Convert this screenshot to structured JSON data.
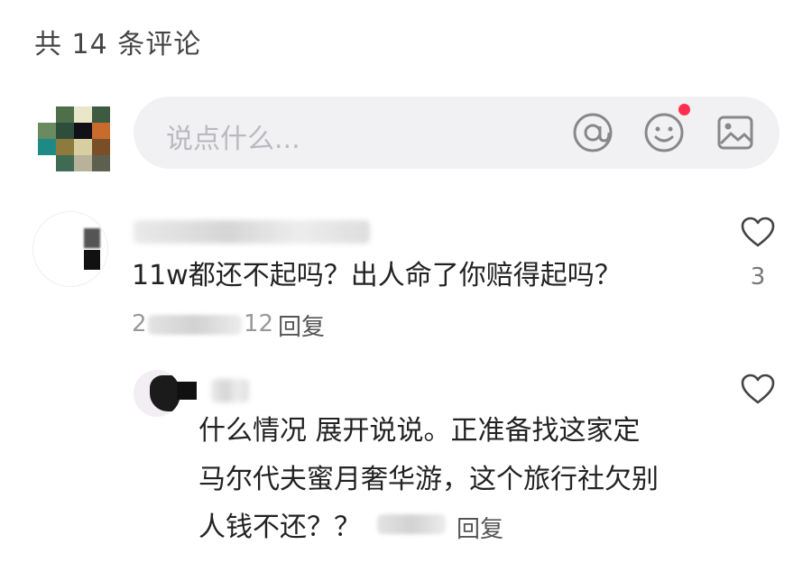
{
  "header": {
    "comment_count_title": "共 14 条评论"
  },
  "composer": {
    "placeholder": "说点什么...",
    "icons": [
      "at-icon",
      "emoji-icon",
      "image-icon"
    ],
    "emoji_has_badge": true
  },
  "comments": [
    {
      "text": "11w都还不起吗？出人命了你赔得起吗？",
      "meta_visible_fragment": "2",
      "meta_visible_fragment_2": "12",
      "reply_label": "回复",
      "like_count": "3"
    },
    {
      "text_line1": "什么情况 展开说说。正准备找这家定",
      "text_line2": "马尔代夫蜜月奢华游，这个旅行社欠别",
      "text_line3": "人钱不还？？",
      "reply_label": "回复"
    }
  ],
  "colors": {
    "badge": "#ff2e4d",
    "composer_bg": "#f1f1f3",
    "icon": "#888888"
  }
}
